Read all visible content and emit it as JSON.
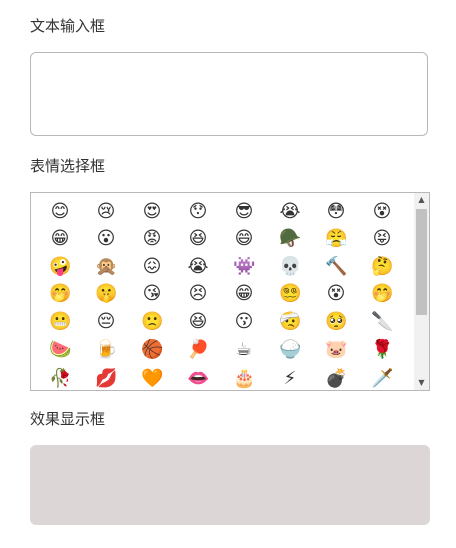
{
  "labels": {
    "text_input": "文本输入框",
    "emoji_select": "表情选择框",
    "result_display": "效果显示框"
  },
  "text_input": {
    "value": "",
    "placeholder": ""
  },
  "emoji_rows": [
    [
      "😊",
      "😢",
      "😍",
      "😯",
      "😎",
      "😭",
      "😳",
      "😵"
    ],
    [
      "😁",
      "😮",
      "😡",
      "😆",
      "😄",
      "🪖",
      "😤",
      "😝"
    ],
    [
      "🤪",
      "🙊",
      "😖",
      "😭",
      "👾",
      "💀",
      "🔨",
      "🤔"
    ],
    [
      "🤭",
      "🤫",
      "😘",
      "😣",
      "😁",
      "😵‍💫",
      "😵",
      "🤭"
    ],
    [
      "😬",
      "😔",
      "🙁",
      "😆",
      "😗",
      "🤕",
      "🥺",
      "🔪"
    ],
    [
      "🍉",
      "🍺",
      "🏀",
      "🏓",
      "☕",
      "🍚",
      "🐷",
      "🌹"
    ],
    [
      "🥀",
      "💋",
      "🧡",
      "👄",
      "🎂",
      "⚡",
      "💣",
      "🗡️"
    ]
  ],
  "colors": {
    "border": "#b8b8b8",
    "result_bg": "#ddd6d6",
    "scroll_thumb": "#c1c1c1"
  }
}
